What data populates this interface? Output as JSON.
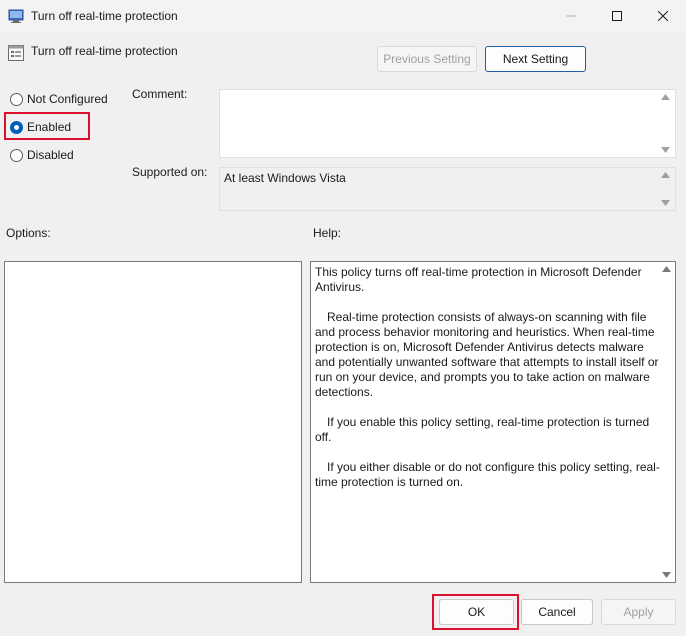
{
  "window": {
    "title": "Turn off real-time protection"
  },
  "header": {
    "policy_name": "Turn off real-time protection",
    "previous_setting_label": "Previous Setting",
    "next_setting_label": "Next Setting"
  },
  "state": {
    "options": [
      "Not Configured",
      "Enabled",
      "Disabled"
    ],
    "selected": "Enabled"
  },
  "fields": {
    "comment_label": "Comment:",
    "comment_value": "",
    "supported_label": "Supported on:",
    "supported_value": "At least Windows Vista"
  },
  "panels": {
    "options_label": "Options:",
    "help_label": "Help:",
    "help_paragraphs": [
      "This policy turns off real-time protection in Microsoft Defender Antivirus.",
      "Real-time protection consists of always-on scanning with file and process behavior monitoring and heuristics. When real-time protection is on, Microsoft Defender Antivirus detects malware and potentially unwanted software that attempts to install itself or run on your device, and prompts you to take action on malware detections.",
      "If you enable this policy setting, real-time protection is turned off.",
      "If you either disable or do not configure this policy setting, real-time protection is turned on."
    ]
  },
  "footer": {
    "ok_label": "OK",
    "cancel_label": "Cancel",
    "apply_label": "Apply"
  },
  "colors": {
    "highlight": "#d9112e",
    "accent": "#005fb8"
  }
}
